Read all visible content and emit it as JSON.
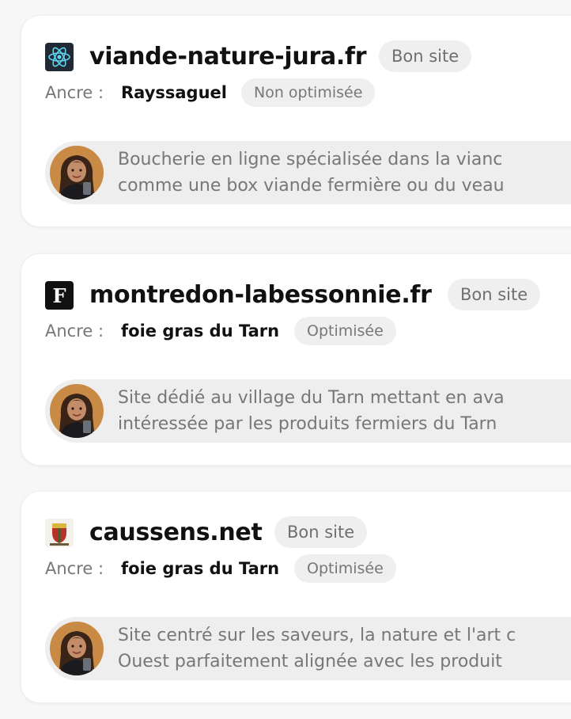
{
  "cards": [
    {
      "site": "viande-nature-jura.fr",
      "badge": "Bon site",
      "anchor_label": "Ancre :",
      "anchor": "Rayssaguel",
      "anchor_status": "Non optimisée",
      "favicon_icon": "react-atom-icon",
      "description": [
        "Boucherie en ligne spécialisée dans la vianc",
        "comme une box viande fermière ou du veau"
      ]
    },
    {
      "site": "montredon-labessonnie.fr",
      "badge": "Bon site",
      "anchor_label": "Ancre :",
      "anchor": "foie gras du Tarn",
      "anchor_status": "Optimisée",
      "favicon_icon": "letter-f-icon",
      "description": [
        "Site dédié au village du Tarn mettant en ava",
        "intéressée par les produits fermiers du Tarn"
      ]
    },
    {
      "site": "caussens.net",
      "badge": "Bon site",
      "anchor_label": "Ancre :",
      "anchor": "foie gras du Tarn",
      "anchor_status": "Optimisée",
      "favicon_icon": "coat-of-arms-icon",
      "description": [
        "Site centré sur les saveurs, la nature et l'art c",
        "Ouest parfaitement alignée avec les produit"
      ]
    }
  ],
  "favicon_f_letter": "F",
  "colors": {
    "background": "#f7f7f7",
    "card": "#ffffff",
    "badge_bg": "#efefef",
    "muted_text": "#777777",
    "strong_text": "#111111"
  }
}
